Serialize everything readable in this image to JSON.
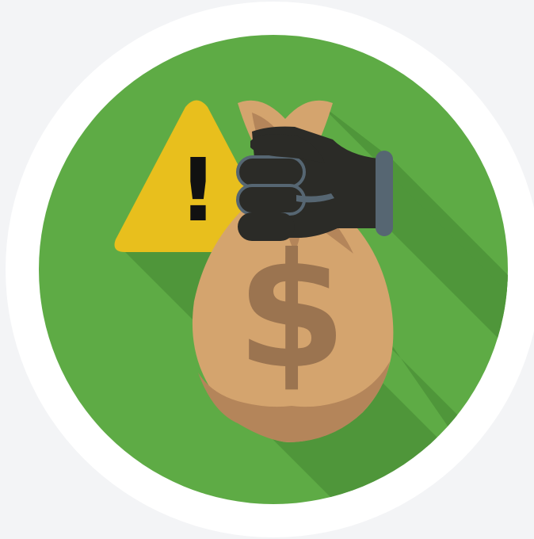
{
  "illustration": {
    "icons": [
      "warning-icon",
      "money-bag-icon",
      "gloved-hand-icon"
    ],
    "warning_mark": "!",
    "currency_symbol": "$"
  },
  "colors": {
    "page_background": "#f3f4f6",
    "ring": "#ffffff",
    "disc": "#5eab45",
    "long_shadow": "#4f963a",
    "warning_yellow": "#e8bf1d",
    "bag_tan": "#d4a46e",
    "bag_shade": "#b4855a",
    "currency_brown": "#9b7450",
    "glove_black": "#2b2b27",
    "cuff_gray": "#566672"
  }
}
